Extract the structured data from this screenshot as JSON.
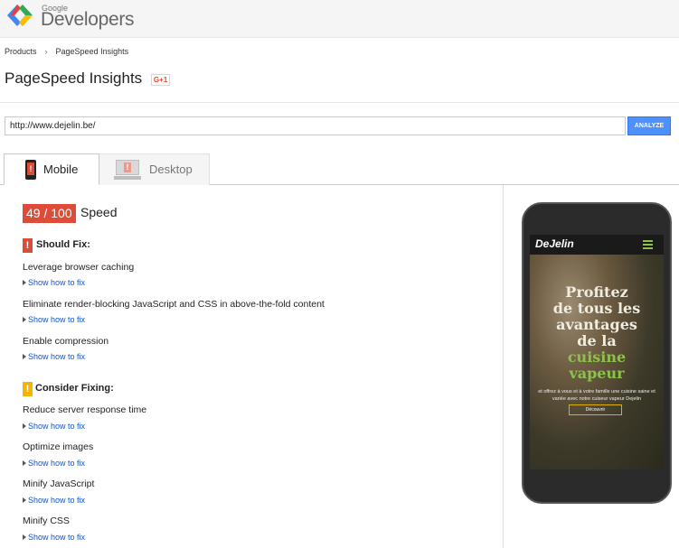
{
  "header": {
    "logo_small": "Google",
    "logo_big": "Developers",
    "logo_icon": "google-developers-chevrons-icon"
  },
  "breadcrumb": [
    "Products",
    "PageSpeed Insights"
  ],
  "page_title": "PageSpeed Insights",
  "gplus_label": "G+1",
  "url_input": {
    "value": "http://www.dejelin.be/"
  },
  "analyze_label": "ANALYZE",
  "tabs": [
    {
      "label": "Mobile",
      "icon": "mobile-phone-icon",
      "active": true
    },
    {
      "label": "Desktop",
      "icon": "desktop-monitor-icon",
      "active": false
    }
  ],
  "score": {
    "value": "49 / 100",
    "label": "Speed",
    "color": "#dd4b39"
  },
  "should_fix": {
    "title": "Should Fix:",
    "badge": "!",
    "color": "#dd4b39",
    "items": [
      {
        "rule": "Leverage browser caching",
        "link": "Show how to fix"
      },
      {
        "rule": "Eliminate render-blocking JavaScript and CSS in above-the-fold content",
        "link": "Show how to fix"
      },
      {
        "rule": "Enable compression",
        "link": "Show how to fix"
      }
    ]
  },
  "consider_fixing": {
    "title": "Consider Fixing:",
    "badge": "!",
    "color": "#f4b400",
    "items": [
      {
        "rule": "Reduce server response time",
        "link": "Show how to fix"
      },
      {
        "rule": "Optimize images",
        "link": "Show how to fix"
      },
      {
        "rule": "Minify JavaScript",
        "link": "Show how to fix"
      },
      {
        "rule": "Minify CSS",
        "link": "Show how to fix"
      }
    ]
  },
  "preview": {
    "brand": "DeJelin",
    "headline_lines": [
      "Profitez",
      "de tous les",
      "avantages",
      "de la"
    ],
    "headline_green": [
      "cuisine",
      "vapeur"
    ],
    "subline": "et offrez à vous et à votre famille une cuisine saine et variée avec notre cuiseur vapeur Dejelin",
    "cta": "Découvrir",
    "accent": "#8bc34a"
  }
}
